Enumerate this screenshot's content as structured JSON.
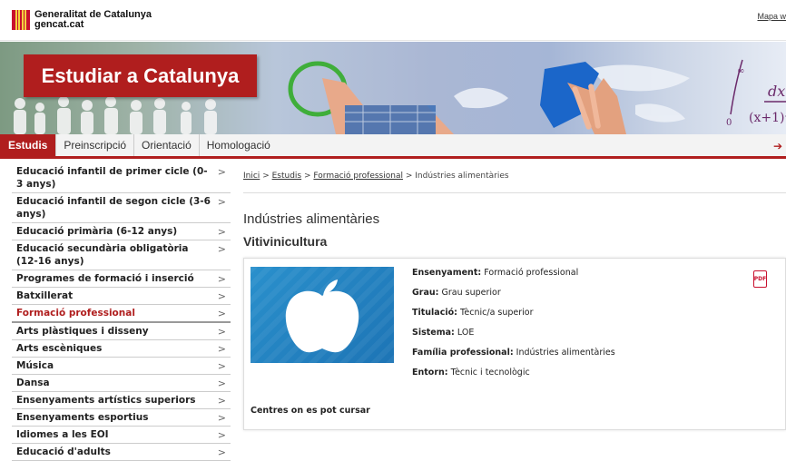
{
  "header": {
    "logo_line1": "Generalitat de Catalunya",
    "logo_line2": "gencat.cat",
    "top_link": "Mapa w"
  },
  "banner": {
    "title": "Estudiar a Catalunya",
    "formula_text": "dx"
  },
  "nav": {
    "items": [
      "Estudis",
      "Preinscripció",
      "Orientació",
      "Homologació"
    ],
    "active_index": 0,
    "right_arrow": "➔"
  },
  "sidebar": {
    "items": [
      {
        "label": "Educació infantil de primer cicle (0-3 anys)"
      },
      {
        "label": "Educació infantil de segon cicle (3-6 anys)"
      },
      {
        "label": "Educació primària (6-12 anys)"
      },
      {
        "label": "Educació secundària obligatòria (12-16 anys)"
      },
      {
        "label": "Programes de formació i inserció"
      },
      {
        "label": "Batxillerat"
      },
      {
        "label": "Formació professional"
      },
      {
        "label": "Arts plàstiques i disseny"
      },
      {
        "label": "Arts escèniques"
      },
      {
        "label": "Música"
      },
      {
        "label": "Dansa"
      },
      {
        "label": "Ensenyaments artístics superiors"
      },
      {
        "label": "Ensenyaments esportius"
      },
      {
        "label": "Idiomes a les EOI"
      },
      {
        "label": "Educació d'adults"
      }
    ],
    "active_index": 6,
    "chevron": ">"
  },
  "breadcrumb": {
    "items": [
      "Inici",
      "Estudis",
      "Formació professional"
    ],
    "current": "Indústries alimentàries",
    "separator": ">"
  },
  "main": {
    "title": "Indústries alimentàries",
    "subtitle": "Vitivinicultura"
  },
  "card": {
    "fields": [
      {
        "label": "Ensenyament:",
        "value": "Formació professional"
      },
      {
        "label": "Grau:",
        "value": "Grau superior"
      },
      {
        "label": "Titulació:",
        "value": "Tècnic/a superior"
      },
      {
        "label": "Sistema:",
        "value": "LOE"
      },
      {
        "label": "Família professional:",
        "value": "Indústries alimentàries"
      },
      {
        "label": "Entorn:",
        "value": "Tècnic i tecnològic"
      }
    ],
    "pdf_label": "PDF",
    "centres_label": "Centres on es pot cursar"
  },
  "colors": {
    "brand_red": "#b01e1e",
    "image_blue": "#2a90cc"
  }
}
